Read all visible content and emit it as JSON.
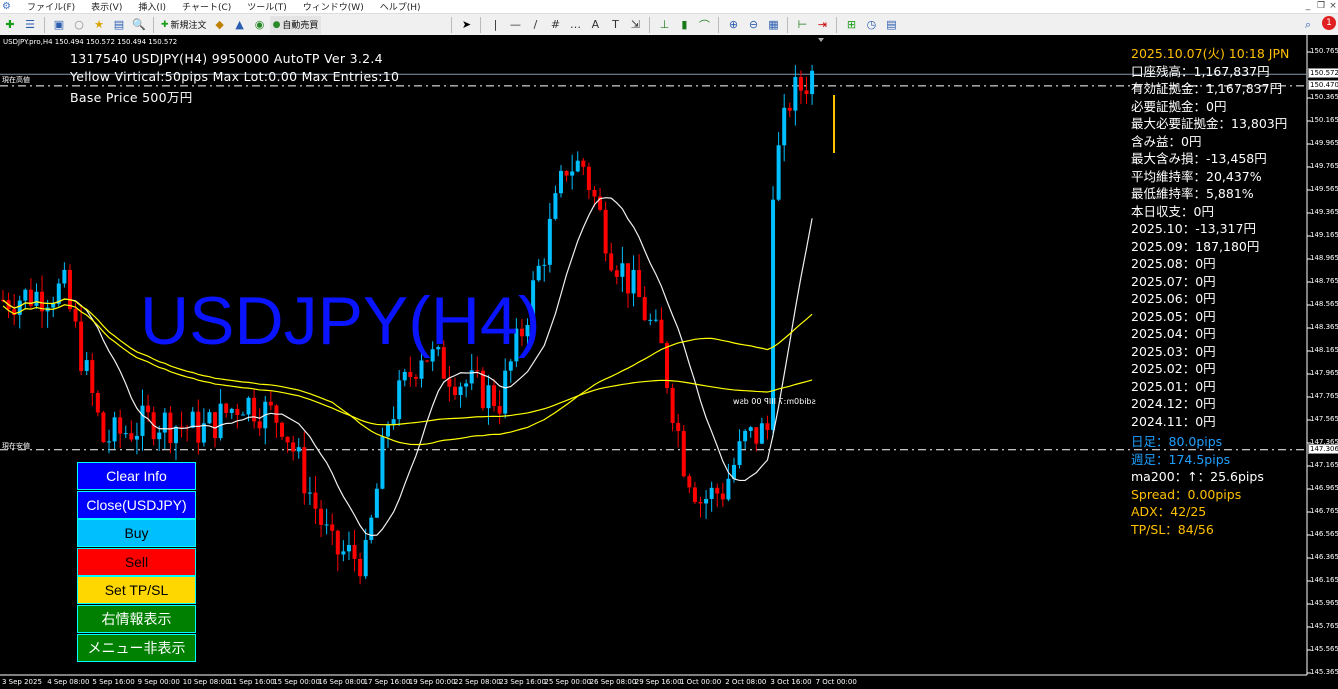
{
  "menu": {
    "app_icon": "mt4-icon",
    "items": [
      "ファイル(F)",
      "表示(V)",
      "挿入(I)",
      "チャート(C)",
      "ツール(T)",
      "ウィンドウ(W)",
      "ヘルプ(H)"
    ]
  },
  "toolbar": {
    "new_order": "新規注文",
    "auto_trading": "自動売買",
    "notification_count": "1"
  },
  "chart": {
    "ohlc_header": "USDJPY.pro,H4  150.494 150.572 150.494 150.572",
    "info_lines": [
      "1317540 USDJPY(H4) 9950000 AutoTP Ver 3.2.4",
      "Yellow Virtical:50pips   Max Lot:0.00 Max Entries:10",
      "Base Price 500万円"
    ],
    "watermark": "USDJPY(H4)",
    "high_line_label": "現在高値",
    "low_line_label": "現在安値",
    "object_label": "sdid0m:7 IIIP 00 dsw",
    "price_labels": [
      "150.765",
      "150.365",
      "150.165",
      "149.965",
      "149.765",
      "149.565",
      "149.365",
      "149.165",
      "148.965",
      "148.765",
      "148.565",
      "148.365",
      "148.165",
      "147.965",
      "147.765",
      "147.565",
      "147.365",
      "147.165",
      "146.965",
      "146.765",
      "146.565",
      "146.365",
      "146.165",
      "145.965",
      "145.765",
      "145.565",
      "145.365"
    ],
    "current_price_tag": "150.572",
    "line_price_tag": "150.470",
    "low_price_tag": "147.306",
    "time_labels": [
      "3 Sep 2025",
      "4 Sep 08:00",
      "5 Sep 16:00",
      "9 Sep 00:00",
      "10 Sep 08:00",
      "11 Sep 16:00",
      "15 Sep 00:00",
      "16 Sep 08:00",
      "17 Sep 16:00",
      "19 Sep 00:00",
      "22 Sep 08:00",
      "23 Sep 16:00",
      "25 Sep 00:00",
      "26 Sep 08:00",
      "29 Sep 16:00",
      "1 Oct 00:00",
      "2 Oct 08:00",
      "3 Oct 16:00",
      "7 Oct 00:00"
    ]
  },
  "right_panel": {
    "datetime": "2025.10.07(火) 10:18  JPN",
    "lines": [
      "口座残高：1,167,837円",
      "有効証拠金：1,167,837円",
      "必要証拠金：0円",
      "最大必要証拠金：13,803円",
      "含み益：0円",
      "最大含み損：-13,458円",
      "平均維持率：20,437%",
      "最低維持率：5,881%",
      "本日収支：0円",
      "2025.10：-13,317円",
      "2025.09：187,180円",
      "2025.08：0円",
      "2025.07：0円",
      "2025.06：0円",
      "2025.05：0円",
      "2025.04：0円",
      "2025.03：0円",
      "2025.02：0円",
      "2025.01：0円",
      "2024.12：0円",
      "2024.11：0円"
    ],
    "daily_range": "日足：80.0pips",
    "weekly_range": "週足：174.5pips",
    "ma200": "ma200：↑：25.6pips",
    "spread": "Spread：0.00pips",
    "adx": "ADX：42/25",
    "tpsl": "TP/SL：84/56"
  },
  "buttons": [
    {
      "label": "Clear Info",
      "bg": "#0000ff",
      "fg": "#ffffff"
    },
    {
      "label": "Close(USDJPY)",
      "bg": "#0000ff",
      "fg": "#ffffff"
    },
    {
      "label": "Buy",
      "bg": "#00bfff",
      "fg": "#000000"
    },
    {
      "label": "Sell",
      "bg": "#ff0000",
      "fg": "#000000"
    },
    {
      "label": "Set TP/SL",
      "bg": "#ffd700",
      "fg": "#000000"
    },
    {
      "label": "右情報表示",
      "bg": "#008000",
      "fg": "#ffffff"
    },
    {
      "label": "メニュー非表示",
      "bg": "#008000",
      "fg": "#ffffff"
    }
  ],
  "chart_data": {
    "type": "candlestick",
    "symbol": "USDJPY",
    "timeframe": "H4",
    "ylim": [
      145.3,
      150.85
    ],
    "bull_color": "#00bfff",
    "bear_color": "#ff0000",
    "price_path": [
      [
        0,
        148.61
      ],
      [
        11,
        148.7
      ],
      [
        18,
        147.39
      ],
      [
        27,
        147.565
      ],
      [
        36,
        147.48
      ],
      [
        43,
        147.74
      ],
      [
        50,
        147.565
      ],
      [
        59,
        146.43
      ],
      [
        65,
        146.35
      ],
      [
        69,
        147.565
      ],
      [
        75,
        148.17
      ],
      [
        82,
        147.91
      ],
      [
        89,
        147.74
      ],
      [
        93,
        148.35
      ],
      [
        97,
        149.04
      ],
      [
        101,
        149.78
      ],
      [
        104,
        149.78
      ],
      [
        109,
        149.04
      ],
      [
        114,
        148.61
      ],
      [
        118,
        148.17
      ],
      [
        122,
        147.22
      ],
      [
        125,
        146.87
      ],
      [
        129,
        146.96
      ],
      [
        133,
        147.39
      ],
      [
        137,
        147.48
      ],
      [
        138,
        149.65
      ],
      [
        141,
        150.35
      ],
      [
        145,
        150.57
      ]
    ],
    "candle_count": 146
  }
}
